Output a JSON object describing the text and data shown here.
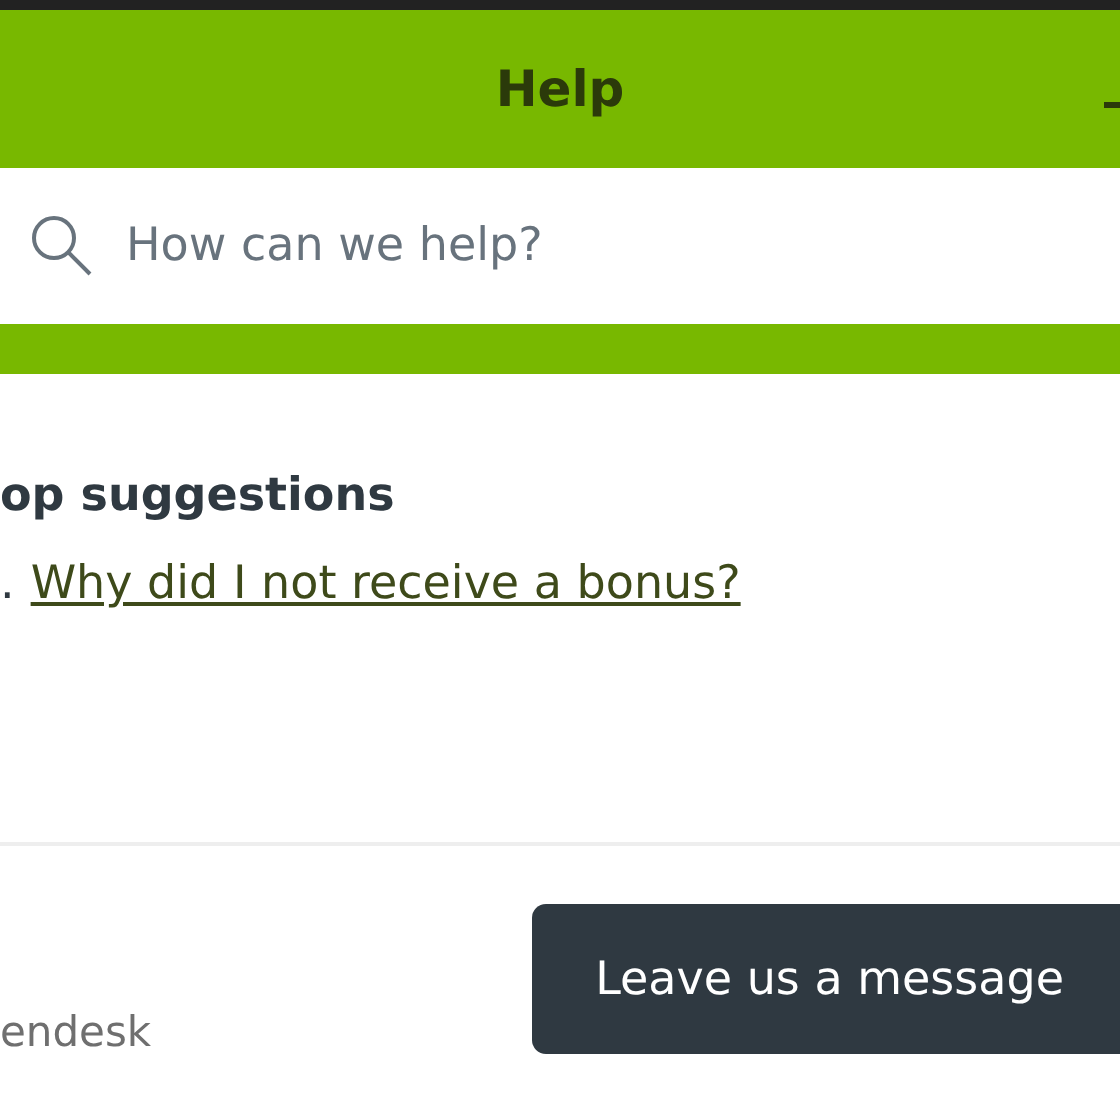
{
  "header": {
    "title": "Help"
  },
  "search": {
    "placeholder": "How can we help?"
  },
  "suggestions": {
    "heading": "op suggestions",
    "items": [
      {
        "number": ".",
        "label": "Why did I not receive a bonus?"
      }
    ]
  },
  "footer": {
    "brand": "endesk",
    "button": "Leave us a message"
  }
}
